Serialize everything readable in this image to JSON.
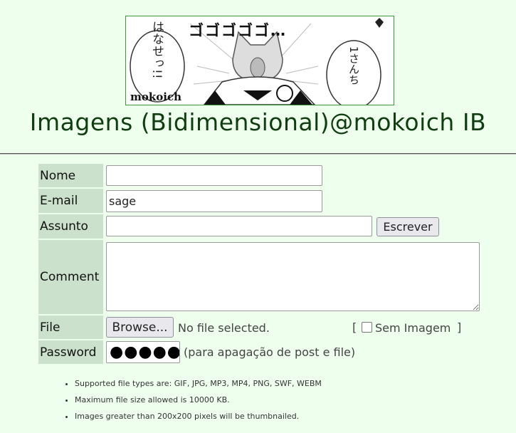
{
  "banner": {
    "caption": "mokoich",
    "manga_sfx": "ゴゴゴゴゴ…",
    "bubble_left": "はなせっ!!",
    "bubble_right": "1さんち"
  },
  "board_title": "Imagens (Bidimensional)@mokoich IB",
  "form": {
    "name_label": "Nome",
    "name_value": "",
    "email_label": "E-mail",
    "email_value": "sage",
    "subject_label": "Assunto",
    "subject_value": "",
    "submit_label": "Escrever",
    "comment_label": "Comment",
    "comment_value": "",
    "file_label": "File",
    "browse_label": "Browse...",
    "no_file_text": "No file selected.",
    "no_image_bracket_open": "[",
    "no_image_label": "Sem Imagem",
    "no_image_bracket_close": "]",
    "password_label": "Password",
    "password_dots": "●●●●●●",
    "password_hint": "(para apagação de post e file)"
  },
  "notes": [
    "Supported file types are: GIF, JPG, MP3, MP4, PNG, SWF, WEBM",
    "Maximum file size allowed is 10000 KB.",
    "Images greater than 200x200 pixels will be thumbnailed."
  ],
  "colors": {
    "page_bg": "#eeffee",
    "label_bg": "#cce1cc",
    "title_color": "#0f3d0f"
  }
}
